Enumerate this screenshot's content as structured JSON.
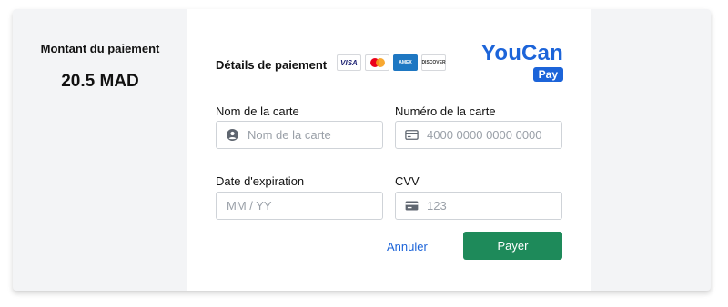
{
  "summary": {
    "label": "Montant du paiement",
    "amount": "20.5 MAD"
  },
  "form": {
    "title": "Détails de paiement",
    "card_logos": [
      "VISA",
      "mastercard",
      "AMERICAN EXPRESS",
      "DISCOVER"
    ],
    "brand": {
      "name": "YouCan",
      "badge": "Pay",
      "color": "#1c64d9"
    },
    "fields": {
      "card_name": {
        "label": "Nom de la carte",
        "placeholder": "Nom de la carte",
        "value": "",
        "icon": "user-circle-icon"
      },
      "card_number": {
        "label": "Numéro de la carte",
        "placeholder": "4000 0000 0000 0000",
        "value": "",
        "icon": "credit-card-icon"
      },
      "expiry": {
        "label": "Date d'expiration",
        "placeholder": "MM / YY",
        "value": ""
      },
      "cvv": {
        "label": "CVV",
        "placeholder": "123",
        "value": "",
        "icon": "card-cvv-icon"
      }
    },
    "actions": {
      "cancel": "Annuler",
      "pay": "Payer",
      "pay_color": "#1e8a5a"
    }
  }
}
